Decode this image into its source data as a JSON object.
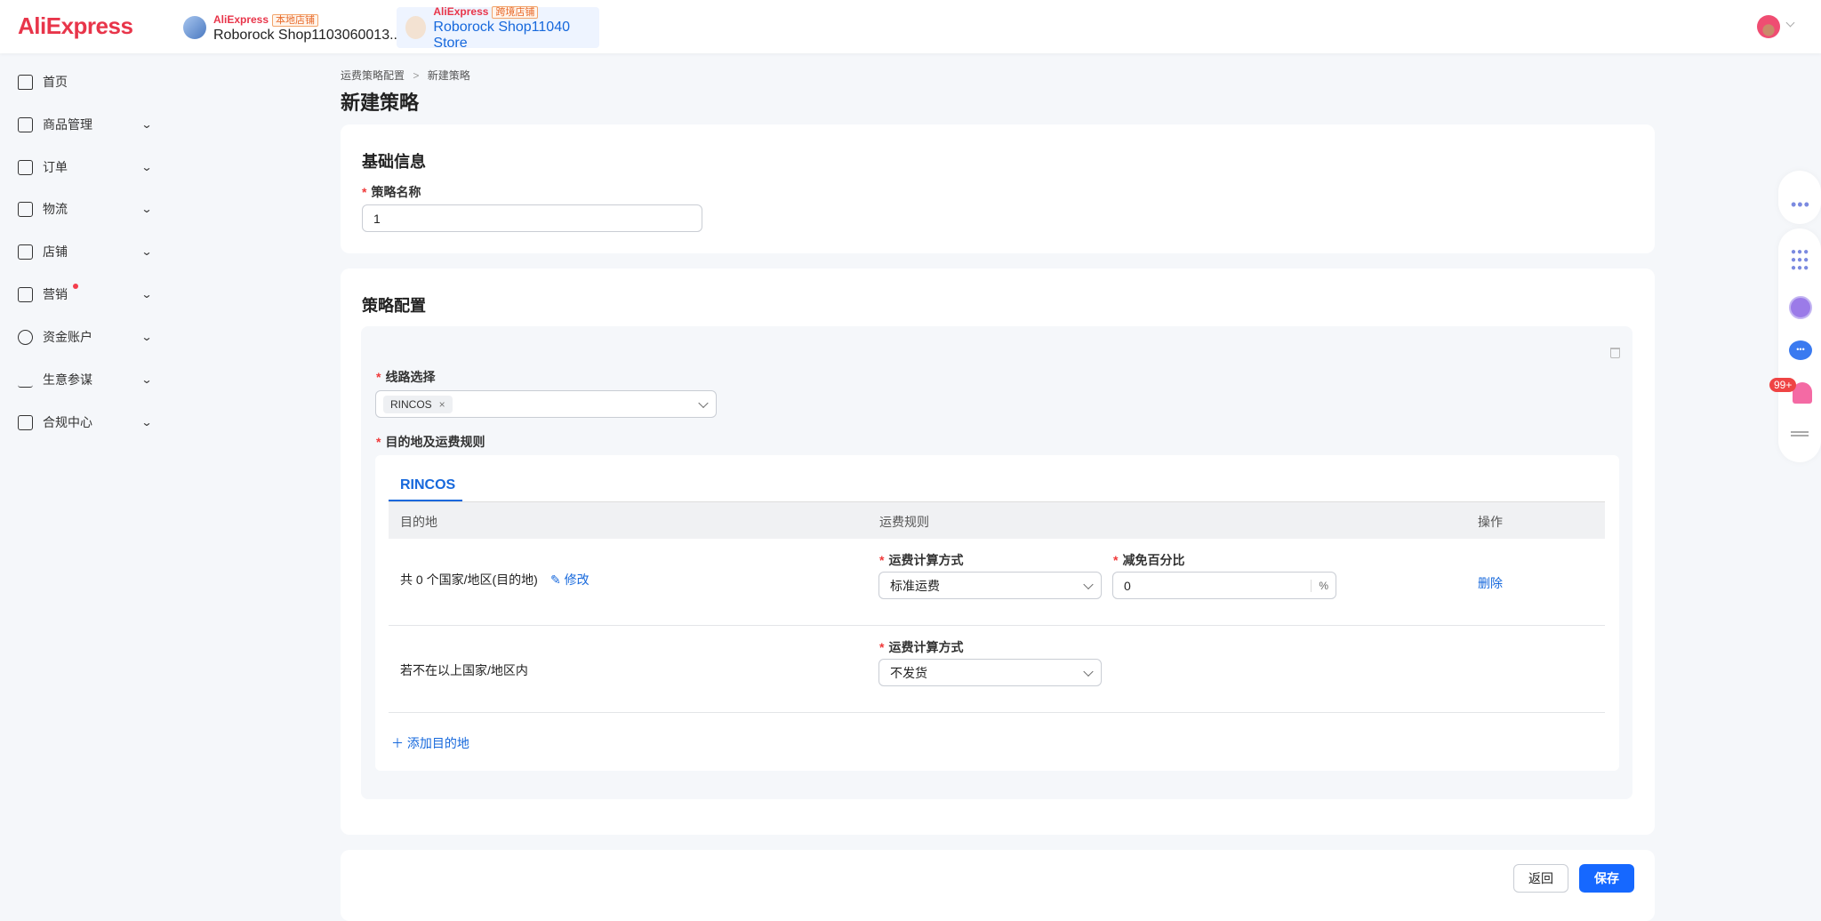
{
  "header": {
    "logo": "AliExpress",
    "shops": [
      {
        "brand": "AliExpress",
        "tag": "本地店铺",
        "name": "Roborock Shop1103060013..."
      },
      {
        "brand": "AliExpress",
        "tag": "跨境店铺",
        "name": "Roborock Shop11040 Store"
      }
    ]
  },
  "sidebar": {
    "items": [
      {
        "label": "首页",
        "icon": "home-icon"
      },
      {
        "label": "商品管理",
        "icon": "bag-icon"
      },
      {
        "label": "订单",
        "icon": "clipboard-icon"
      },
      {
        "label": "物流",
        "icon": "box-icon"
      },
      {
        "label": "店铺",
        "icon": "store-icon"
      },
      {
        "label": "营销",
        "icon": "ticket-icon",
        "badge": true
      },
      {
        "label": "资金账户",
        "icon": "dollar-icon"
      },
      {
        "label": "生意参谋",
        "icon": "chart-icon"
      },
      {
        "label": "合规中心",
        "icon": "alert-icon"
      }
    ]
  },
  "breadcrumb": {
    "parent": "运费策略配置",
    "separator": ">",
    "current": "新建策略"
  },
  "page_title": "新建策略",
  "basic": {
    "title": "基础信息",
    "name_label": "策略名称",
    "name_value": "1"
  },
  "config": {
    "title": "策略配置",
    "route_label": "线路选择",
    "route_tag": "RINCOS",
    "dest_label": "目的地及运费规则",
    "tab": "RINCOS",
    "columns": [
      "目的地",
      "运费规则",
      "操作"
    ],
    "row1": {
      "dest": "共 0 个国家/地区(目的地)",
      "edit": "修改",
      "calc_label": "运费计算方式",
      "calc_value": "标准运费",
      "discount_label": "减免百分比",
      "discount_value": "0",
      "unit": "%",
      "delete": "删除"
    },
    "row2": {
      "dest": "若不在以上国家/地区内",
      "calc_label": "运费计算方式",
      "calc_value": "不发货"
    },
    "add": "添加目的地"
  },
  "footer": {
    "back": "返回",
    "save": "保存"
  },
  "float": {
    "badge": "99+"
  },
  "colors": {
    "brand": "#e8354a",
    "primary": "#1668dc",
    "required": "#f03a3a"
  }
}
